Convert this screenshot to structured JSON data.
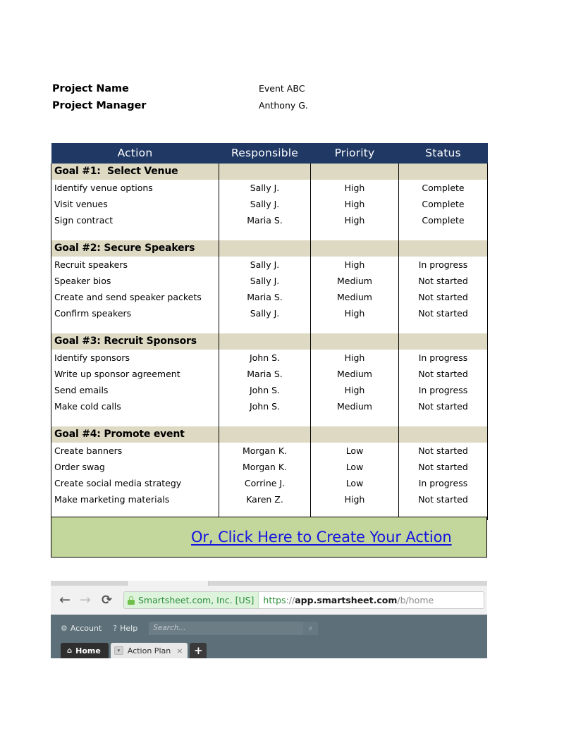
{
  "project": {
    "name_label": "Project Name",
    "name_value": "Event ABC",
    "manager_label": "Project Manager",
    "manager_value": "Anthony G."
  },
  "table": {
    "headers": [
      "Action",
      "Responsible",
      "Priority",
      "Status"
    ],
    "sections": [
      {
        "goal": "Goal #1:  Select Venue",
        "rows": [
          {
            "action": "Identify venue options",
            "responsible": "Sally J.",
            "priority": "High",
            "status": "Complete"
          },
          {
            "action": "Visit venues",
            "responsible": "Sally J.",
            "priority": "High",
            "status": "Complete"
          },
          {
            "action": "Sign contract",
            "responsible": "Maria S.",
            "priority": "High",
            "status": "Complete"
          }
        ]
      },
      {
        "goal": "Goal #2: Secure Speakers",
        "rows": [
          {
            "action": "Recruit speakers",
            "responsible": "Sally J.",
            "priority": "High",
            "status": "In progress"
          },
          {
            "action": "Speaker bios",
            "responsible": "Sally J.",
            "priority": "Medium",
            "status": "Not started"
          },
          {
            "action": "Create and send speaker packets",
            "responsible": "Maria S.",
            "priority": "Medium",
            "status": "Not started"
          },
          {
            "action": "Confirm speakers",
            "responsible": "Sally J.",
            "priority": "High",
            "status": "Not started"
          }
        ]
      },
      {
        "goal": "Goal #3: Recruit Sponsors",
        "rows": [
          {
            "action": "Identify sponsors",
            "responsible": "John S.",
            "priority": "High",
            "status": "In progress"
          },
          {
            "action": "Write up sponsor agreement",
            "responsible": "Maria S.",
            "priority": "Medium",
            "status": "Not started"
          },
          {
            "action": "Send emails",
            "responsible": "John S.",
            "priority": "High",
            "status": "In progress"
          },
          {
            "action": "Make cold calls",
            "responsible": "John S.",
            "priority": "Medium",
            "status": "Not started"
          }
        ]
      },
      {
        "goal": "Goal #4: Promote event",
        "rows": [
          {
            "action": "Create banners",
            "responsible": "Morgan K.",
            "priority": "Low",
            "status": "Not started"
          },
          {
            "action": "Order swag",
            "responsible": "Morgan K.",
            "priority": "Low",
            "status": "Not started"
          },
          {
            "action": "Create social media strategy",
            "responsible": "Corrine J.",
            "priority": "Low",
            "status": "In progress"
          },
          {
            "action": "Make marketing materials",
            "responsible": "Karen Z.",
            "priority": "High",
            "status": "Not started"
          }
        ]
      }
    ]
  },
  "cta": {
    "link_text": "Or, Click Here to Create Your Action"
  },
  "browser": {
    "back_glyph": "←",
    "forward_glyph": "→",
    "reload_glyph": "⟳",
    "ev_badge": "Smartsheet.com, Inc. [US]",
    "url_scheme": "https",
    "url_sep": "://",
    "url_host": "app.smartsheet.com",
    "url_path": "/b/home"
  },
  "app": {
    "account_label": "Account",
    "account_glyph": "⚙",
    "help_label": "Help",
    "help_glyph": "?",
    "search_placeholder": "Search...",
    "search_glyph": "⌕",
    "tab_home": "Home",
    "home_glyph": "⌂",
    "tab_action_plan": "Action Plan",
    "tab_caret_glyph": "▾",
    "tab_close_glyph": "×",
    "tab_add_glyph": "+"
  },
  "colors": {
    "header_navy": "#1F3864",
    "goal_beige": "#DDD9C3",
    "cta_green": "#C3D69B",
    "link_blue": "#1414E0",
    "app_bar": "#5D7079"
  }
}
